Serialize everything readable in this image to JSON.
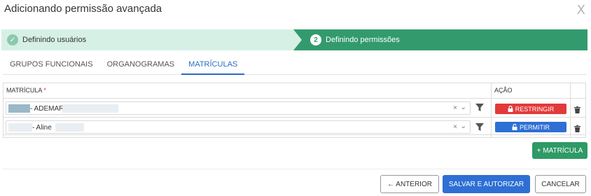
{
  "modal": {
    "title": "Adicionando permissão avançada",
    "close": "X"
  },
  "stepper": {
    "step1": {
      "check": "✓",
      "label": "Definindo usuários"
    },
    "step2": {
      "number": "2",
      "label": "Definindo permissões"
    }
  },
  "tabs": [
    "GRUPOS FUNCIONAIS",
    "ORGANOGRAMAS",
    "MATRÍCULAS"
  ],
  "active_tab": "MATRÍCULAS",
  "table": {
    "headers": {
      "matricula": "MATRÍCULA",
      "required": "*",
      "acao": "AÇÃO"
    },
    "rows": [
      {
        "matricula": "- ADEMAR",
        "clear": "×",
        "action_label": "RESTRINGIR",
        "action_color": "#e23a3a"
      },
      {
        "matricula": "- Aline",
        "clear": "×",
        "action_label": "PERMITIR",
        "action_color": "#2e6fd4"
      }
    ]
  },
  "buttons": {
    "add_matricula": "+ MATRÍCULA",
    "previous": "← ANTERIOR",
    "save": "SALVAR E AUTORIZAR",
    "cancel": "CANCELAR"
  },
  "colors": {
    "primary": "#2e6fd4",
    "success": "#2f9a66",
    "danger": "#e23a3a",
    "step_done_bg": "#d6f0e6",
    "step_active_bg": "#339a6e"
  }
}
